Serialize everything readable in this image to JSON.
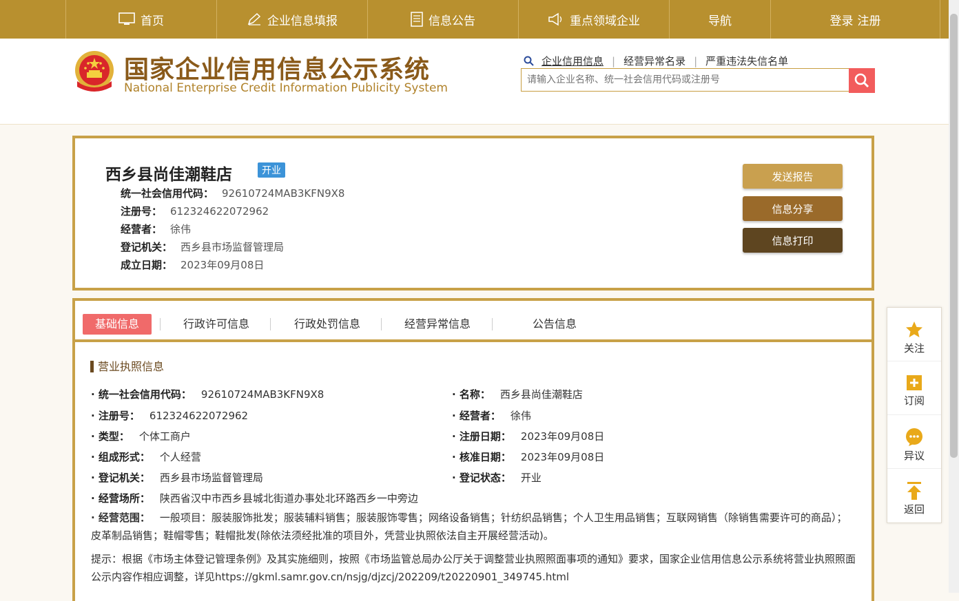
{
  "nav": {
    "items": [
      {
        "label": "首页",
        "icon": "monitor-icon"
      },
      {
        "label": "企业信息填报",
        "icon": "pen-icon"
      },
      {
        "label": "信息公告",
        "icon": "document-icon"
      },
      {
        "label": "重点领域企业",
        "icon": "megaphone-icon"
      },
      {
        "label": "导航",
        "icon": ""
      }
    ],
    "login": "登录",
    "register": "注册"
  },
  "header": {
    "title_cn": "国家企业信用信息公示系统",
    "title_en": "National Enterprise Credit Information Publicity System",
    "search_tabs": [
      "企业信用信息",
      "经营异常名录",
      "严重违法失信名单"
    ],
    "search_placeholder": "请输入企业名称、统一社会信用代码或注册号"
  },
  "company": {
    "name": "西乡县尚佳潮鞋店",
    "status": "开业",
    "lines": [
      {
        "label": "统一社会信用代码：",
        "value": "92610724MAB3KFN9X8"
      },
      {
        "label": "注册号：",
        "value": "612324622072962"
      },
      {
        "label": "经营者：",
        "value": "徐伟"
      },
      {
        "label": "登记机关：",
        "value": "西乡县市场监督管理局"
      },
      {
        "label": "成立日期：",
        "value": "2023年09月08日"
      }
    ],
    "buttons": {
      "send": "发送报告",
      "share": "信息分享",
      "print": "信息打印"
    }
  },
  "tabs": [
    "基础信息",
    "行政许可信息",
    "行政处罚信息",
    "经营异常信息",
    "公告信息"
  ],
  "license": {
    "section_title": "营业执照信息",
    "left": [
      {
        "label": "· 统一社会信用代码：",
        "value": "92610724MAB3KFN9X8"
      },
      {
        "label": "· 注册号：",
        "value": "612324622072962"
      },
      {
        "label": "· 类型：",
        "value": "个体工商户"
      },
      {
        "label": "· 组成形式：",
        "value": "个人经营"
      },
      {
        "label": "· 登记机关：",
        "value": "西乡县市场监督管理局"
      },
      {
        "label": "· 经营场所：",
        "value": "陕西省汉中市西乡县城北街道办事处北环路西乡一中旁边"
      }
    ],
    "right": [
      {
        "label": "· 名称：",
        "value": "西乡县尚佳潮鞋店"
      },
      {
        "label": "· 经营者：",
        "value": "徐伟"
      },
      {
        "label": "· 注册日期：",
        "value": "2023年09月08日"
      },
      {
        "label": "· 核准日期：",
        "value": "2023年09月08日"
      },
      {
        "label": "· 登记状态：",
        "value": "开业"
      }
    ],
    "scope_label": "· 经营范围：",
    "scope_value": "一般项目：服装服饰批发；服装辅料销售；服装服饰零售；网络设备销售；针纺织品销售；个人卫生用品销售；互联网销售（除销售需要许可的商品）；皮革制品销售；鞋帽零售；鞋帽批发(除依法须经批准的项目外，凭营业执照依法自主开展经营活动)。",
    "note": "提示：根据《市场主体登记管理条例》及其实施细则，按照《市场监管总局办公厅关于调整营业执照照面事项的通知》要求，国家企业信用信息公示系统将营业执照照面公示内容作相应调整，详见https://gkml.samr.gov.cn/nsjg/djzcj/202209/t20220901_349745.html"
  },
  "side": {
    "follow": "关注",
    "subscribe": "订阅",
    "objection": "异议",
    "back": "返回"
  },
  "colors": {
    "nav_bg": "#b8902f",
    "border_gold": "#c8a148",
    "btn_send": "#c9a04f",
    "btn_share": "#9a6a2a",
    "btn_print": "#5e4520",
    "tab_active": "#f06a6a",
    "status_tag": "#3c93d8",
    "search_btn": "#f25c5c"
  }
}
